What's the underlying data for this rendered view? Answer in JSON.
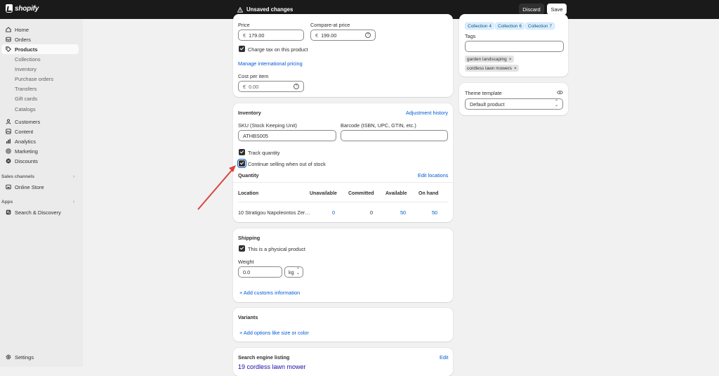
{
  "topbar": {
    "logo": "shopify",
    "status": "Unsaved changes",
    "discard": "Discard",
    "save": "Save"
  },
  "sidebar": {
    "items": [
      {
        "label": "Home",
        "icon": "home-icon"
      },
      {
        "label": "Orders",
        "icon": "orders-icon"
      },
      {
        "label": "Products",
        "icon": "tag-icon"
      },
      {
        "label": "Collections"
      },
      {
        "label": "Inventory"
      },
      {
        "label": "Purchase orders"
      },
      {
        "label": "Transfers"
      },
      {
        "label": "Gift cards"
      },
      {
        "label": "Catalogs"
      },
      {
        "label": "Customers",
        "icon": "person-icon"
      },
      {
        "label": "Content",
        "icon": "content-icon"
      },
      {
        "label": "Analytics",
        "icon": "chart-icon"
      },
      {
        "label": "Marketing",
        "icon": "target-icon"
      },
      {
        "label": "Discounts",
        "icon": "discount-icon"
      }
    ],
    "sales_channels": "Sales channels",
    "online_store": "Online Store",
    "apps": "Apps",
    "search_discovery": "Search & Discovery",
    "settings": "Settings"
  },
  "pricing": {
    "price_label": "Price",
    "price_currency": "€",
    "price_value": "179.00",
    "compare_label": "Compare-at price",
    "compare_currency": "€",
    "compare_value": "199.00",
    "charge_tax": "Charge tax on this product",
    "manage_intl": "Manage international pricing",
    "cost_label": "Cost per item",
    "cost_currency": "€",
    "cost_placeholder": "0.00"
  },
  "inventory": {
    "title": "Inventory",
    "adjustment_history": "Adjustment history",
    "sku_label": "SKU (Stock Keeping Unit)",
    "sku_value": "ATHBS005",
    "barcode_label": "Barcode (ISBN, UPC, GTIN, etc.)",
    "barcode_value": "",
    "track_quantity": "Track quantity",
    "continue_selling": "Continue selling when out of stock",
    "quantity_label": "Quantity",
    "edit_locations": "Edit locations",
    "columns": [
      "Location",
      "Unavailable",
      "Committed",
      "Available",
      "On hand"
    ],
    "row": {
      "location": "10 Stratigou Napoleontos Zer…",
      "unavailable": "0",
      "committed": "0",
      "available": "50",
      "on_hand": "50"
    }
  },
  "shipping": {
    "title": "Shipping",
    "physical": "This is a physical product",
    "weight_label": "Weight",
    "weight_value": "0.0",
    "unit": "kg",
    "customs": "Add customs information"
  },
  "variants": {
    "title": "Variants",
    "add_options": "Add options like size or color"
  },
  "seo": {
    "title": "Search engine listing",
    "edit": "Edit",
    "preview_title": "19 cordless lawn mower"
  },
  "organization": {
    "collections": [
      "Collection 4",
      "Collection 6",
      "Collection 7"
    ],
    "tags_label": "Tags",
    "tags_value": "",
    "tags": [
      "garden landscaping",
      "cordless lawn mowers"
    ]
  },
  "theme": {
    "label": "Theme template",
    "value": "Default product"
  },
  "colors": {
    "topbar": "#1a1a1a",
    "link": "#005bd3",
    "annotation_arrow": "#d9463e"
  }
}
